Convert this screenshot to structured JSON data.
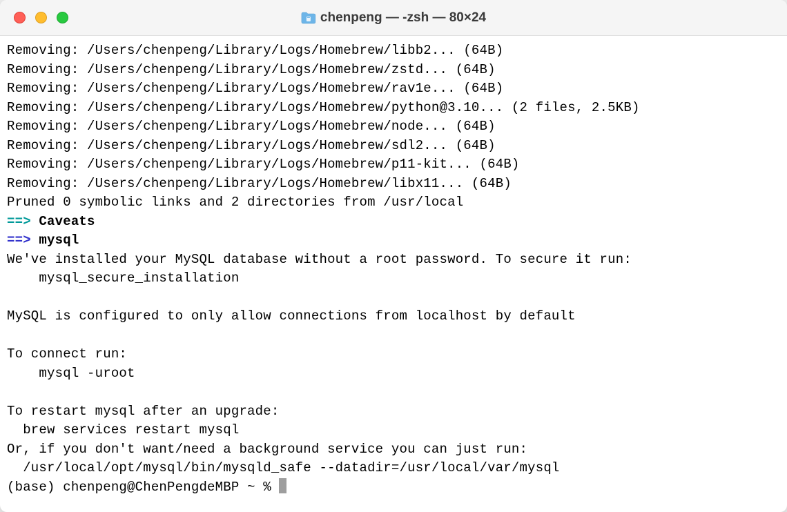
{
  "titlebar": {
    "title": "chenpeng — -zsh — 80×24"
  },
  "terminal": {
    "lines": [
      "Removing: /Users/chenpeng/Library/Logs/Homebrew/libb2... (64B)",
      "Removing: /Users/chenpeng/Library/Logs/Homebrew/zstd... (64B)",
      "Removing: /Users/chenpeng/Library/Logs/Homebrew/rav1e... (64B)",
      "Removing: /Users/chenpeng/Library/Logs/Homebrew/python@3.10... (2 files, 2.5KB)",
      "Removing: /Users/chenpeng/Library/Logs/Homebrew/node... (64B)",
      "Removing: /Users/chenpeng/Library/Logs/Homebrew/sdl2... (64B)",
      "Removing: /Users/chenpeng/Library/Logs/Homebrew/p11-kit... (64B)",
      "Removing: /Users/chenpeng/Library/Logs/Homebrew/libx11... (64B)"
    ],
    "pruned": "Pruned 0 symbolic links and 2 directories from /usr/local",
    "arrow": "==>",
    "caveats_heading": "Caveats",
    "mysql_heading": "mysql",
    "mysql_info_1": "We've installed your MySQL database without a root password. To secure it run:",
    "mysql_info_2": "    mysql_secure_installation",
    "blank": "",
    "mysql_info_3": "MySQL is configured to only allow connections from localhost by default",
    "mysql_info_4": "To connect run:",
    "mysql_info_5": "    mysql -uroot",
    "mysql_info_6": "To restart mysql after an upgrade:",
    "mysql_info_7": "  brew services restart mysql",
    "mysql_info_8": "Or, if you don't want/need a background service you can just run:",
    "mysql_info_9": "  /usr/local/opt/mysql/bin/mysqld_safe --datadir=/usr/local/var/mysql",
    "prompt": "(base) chenpeng@ChenPengdeMBP ~ % "
  }
}
